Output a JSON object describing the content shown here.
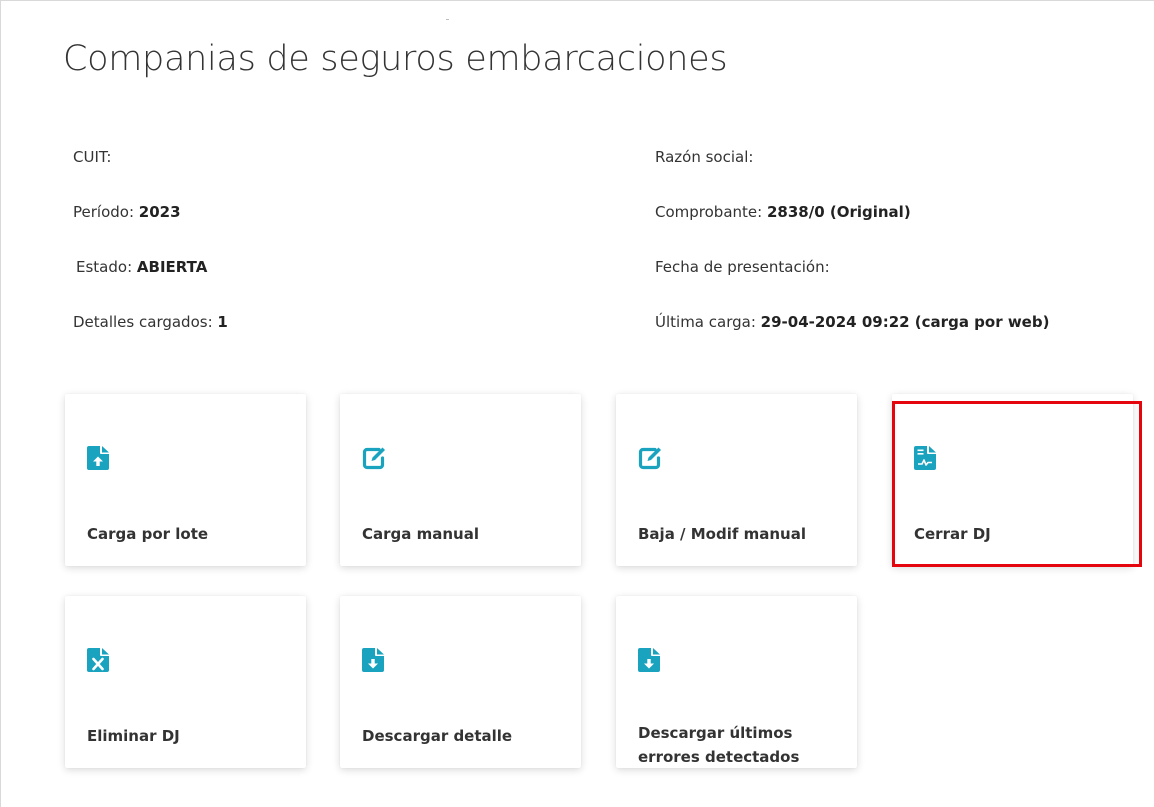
{
  "page": {
    "title": "Companias de seguros embarcaciones"
  },
  "info": {
    "cuit_label": "CUIT:",
    "cuit_value": "",
    "razon_label": "Razón social:",
    "razon_value": "",
    "periodo_label": "Período:",
    "periodo_value": "2023",
    "comprobante_label": "Comprobante:",
    "comprobante_value": "2838/0 (Original)",
    "estado_label": "Estado:",
    "estado_value": "ABIERTA",
    "fecha_label": "Fecha de presentación:",
    "fecha_value": "",
    "detalles_label": "Detalles cargados:",
    "detalles_value": "1",
    "ultima_label": "Última carga:",
    "ultima_value": "29-04-2024 09:22 (carga por web)"
  },
  "tiles": {
    "carga_lote": {
      "label": "Carga por lote",
      "icon": "file-upload-icon"
    },
    "carga_manual": {
      "label": "Carga manual",
      "icon": "edit-icon"
    },
    "baja_modif": {
      "label": "Baja / Modif manual",
      "icon": "edit-icon"
    },
    "cerrar_dj": {
      "label": "Cerrar DJ",
      "icon": "file-signature-icon"
    },
    "eliminar_dj": {
      "label": "Eliminar DJ",
      "icon": "file-excel-icon"
    },
    "descargar_detalle": {
      "label": "Descargar detalle",
      "icon": "file-download-icon"
    },
    "descargar_errores": {
      "label": "Descargar últimos errores detectados",
      "icon": "file-download-icon"
    }
  },
  "colors": {
    "icon": "#1aa3bf",
    "highlight": "#e4060c"
  }
}
